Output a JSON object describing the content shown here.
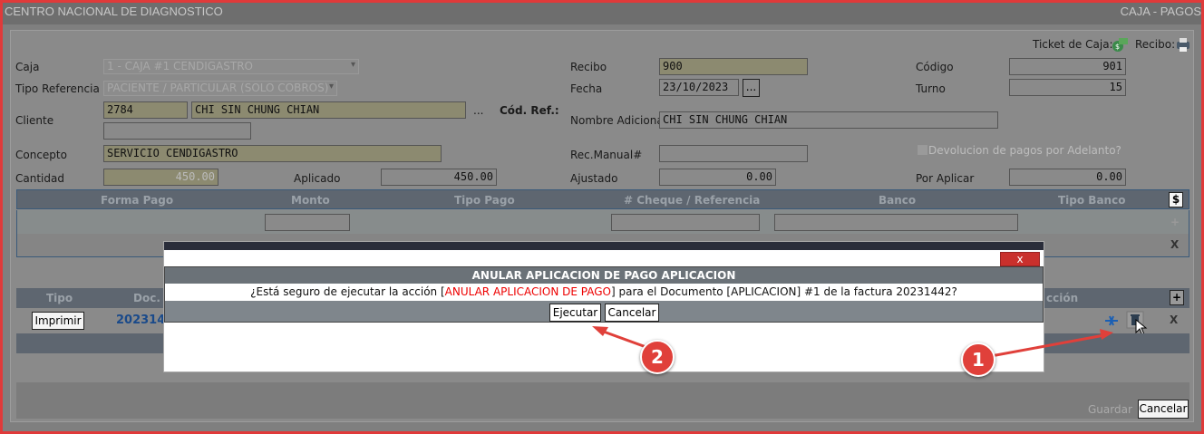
{
  "window": {
    "title_left": "CENTRO NACIONAL DE DIAGNOSTICO",
    "title_right": "CAJA - PAGOS"
  },
  "tickets": {
    "ticket_label": "Ticket de Caja:",
    "recibo_label": "Recibo:"
  },
  "form": {
    "caja_label": "Caja",
    "caja_value": "1 - CAJA #1 CENDIGASTRO",
    "tipo_ref_label": "Tipo Referencia",
    "tipo_ref_value": "PACIENTE / PARTICULAR (SOLO COBROS)",
    "cliente_label": "Cliente",
    "cliente_code": "2784",
    "cliente_name": "CHI SIN CHUNG CHIAN",
    "cliente_more": "...",
    "cod_ref_label": "Cód. Ref.:",
    "concepto_label": "Concepto",
    "concepto_value": "SERVICIO CENDIGASTRO",
    "cantidad_label": "Cantidad",
    "cantidad_value": "450.00",
    "aplicado_label": "Aplicado",
    "aplicado_value": "450.00",
    "recibo_label": "Recibo",
    "recibo_value": "900",
    "fecha_label": "Fecha",
    "fecha_value": "23/10/2023",
    "fecha_btn": "...",
    "nombre_adicional_label": "Nombre Adicional",
    "nombre_adicional_value": "CHI SIN CHUNG CHIAN",
    "rec_manual_label": "Rec.Manual#",
    "ajustado_label": "Ajustado",
    "ajustado_value": "0.00",
    "codigo_label": "Código",
    "codigo_value": "901",
    "turno_label": "Turno",
    "turno_value": "15",
    "devolucion_label": "Devolucion de pagos por Adelanto?",
    "por_aplicar_label": "Por Aplicar",
    "por_aplicar_value": "0.00"
  },
  "pagos_grid": {
    "headers": [
      "Forma Pago",
      "Monto",
      "Tipo Pago",
      "# Cheque / Referencia",
      "Banco",
      "Tipo Banco"
    ],
    "dollar_btn": "$",
    "add_btn": "+",
    "remove_btn": "X"
  },
  "docs_grid": {
    "headers": {
      "tipo": "Tipo",
      "doc": "Doc.",
      "accion": "cción"
    },
    "add_btn": "+",
    "row": {
      "print_btn": "Imprimir",
      "doc": "202314",
      "remove_btn": "X"
    }
  },
  "dialog": {
    "close": "x",
    "title": "ANULAR APLICACION DE PAGO APLICACION",
    "msg_pre": "¿Está seguro de ejecutar la acción [",
    "msg_action": "ANULAR APLICACION DE PAGO",
    "msg_post": "] para el Documento [APLICACION] #1 de la factura 20231442?",
    "execute_btn": "Ejecutar",
    "cancel_btn": "Cancelar"
  },
  "footer": {
    "guardar_btn": "Guardar",
    "cancelar_btn": "Cancelar"
  },
  "annotations": {
    "badge1": "1",
    "badge2": "2"
  },
  "colors": {
    "frame_border": "#e03a3a",
    "badge": "#e0403a",
    "dialog_header": "#6b7278",
    "highlight_red": "#e00000"
  }
}
